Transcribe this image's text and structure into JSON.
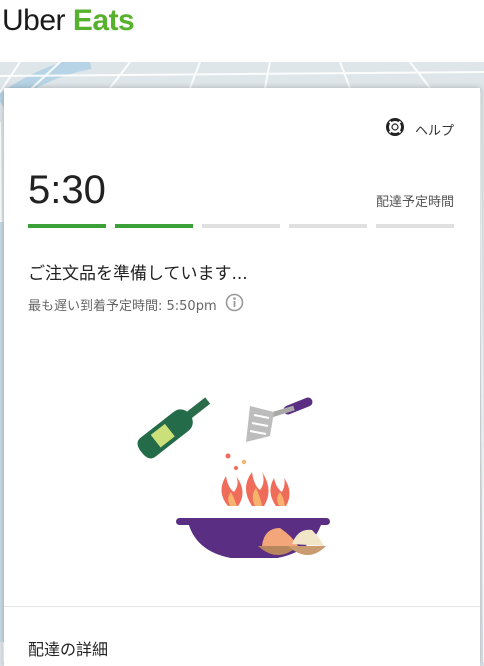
{
  "header": {
    "logo_uber": "Uber",
    "logo_eats": "Eats",
    "brand_green": "#56b22c"
  },
  "order_card": {
    "help_label": "ヘルプ",
    "eta_time": "5:30",
    "eta_label": "配達予定時間",
    "progress": {
      "total_steps": 5,
      "completed_steps": 2,
      "active_color": "#3aa037",
      "inactive_color": "#e0e0e0"
    },
    "status_title": "ご注文品を準備しています...",
    "latest_arrival": "最も遅い到着予定時間: 5:50pm",
    "illustration": "cooking-illustration",
    "details_label": "配達の詳細"
  }
}
